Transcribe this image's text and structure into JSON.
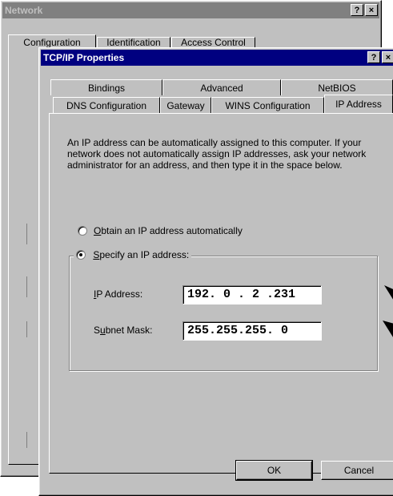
{
  "network_window": {
    "title": "Network",
    "help_btn": "?",
    "close_btn": "×",
    "tabs": [
      "Configuration",
      "Identification",
      "Access Control"
    ]
  },
  "tcpip_dialog": {
    "title": "TCP/IP Properties",
    "help_btn": "?",
    "close_btn": "×",
    "tabs_back": [
      "Bindings",
      "Advanced",
      "NetBIOS"
    ],
    "tabs_front": [
      "DNS Configuration",
      "Gateway",
      "WINS Configuration",
      "IP Address"
    ],
    "description": "An IP address can be automatically assigned to this computer. If your network does not automatically assign IP addresses, ask your network administrator for an address, and then type it in the space below.",
    "radio_auto": {
      "key": "O",
      "rest": "btain an IP address automatically"
    },
    "radio_specify": {
      "key": "S",
      "rest": "pecify an IP address:"
    },
    "ip_label": {
      "key": "I",
      "rest": "P Address:"
    },
    "subnet_label": {
      "pre": "S",
      "key": "u",
      "rest": "bnet Mask:"
    },
    "ip_value": "192. 0 . 2 .231",
    "subnet_value": "255.255.255. 0",
    "ok_label": "OK",
    "cancel_label": "Cancel"
  }
}
